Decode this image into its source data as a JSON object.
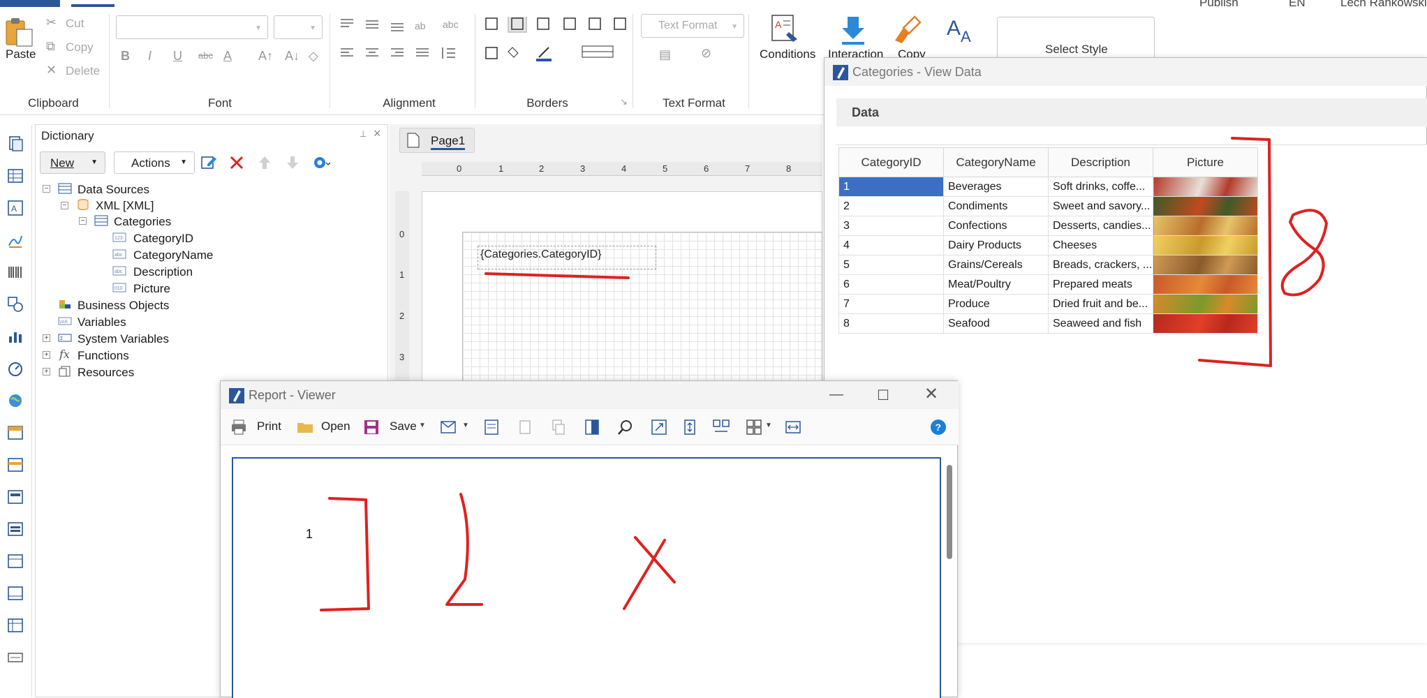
{
  "ribbon": {
    "clipboard": {
      "paste_label": "Paste",
      "cut_label": "Cut",
      "copy_label": "Copy",
      "delete_label": "Delete",
      "group_label": "Clipboard"
    },
    "font": {
      "group_label": "Font"
    },
    "alignment": {
      "group_label": "Alignment"
    },
    "borders": {
      "group_label": "Borders"
    },
    "text_format": {
      "combo_label": "Text Format",
      "group_label": "Text Format"
    },
    "conditions_label": "Conditions",
    "interaction_label": "Interaction",
    "copy_style_label": "Copy",
    "select_style_label": "Select Style",
    "top_right": {
      "publish": "Publish",
      "lang": "EN",
      "user": "Lech Rahkowski"
    }
  },
  "dictionary": {
    "title": "Dictionary",
    "new_button": "New",
    "actions_button": "Actions",
    "tree": {
      "data_sources": "Data Sources",
      "xml": "XML [XML]",
      "categories": "Categories",
      "fields": [
        "CategoryID",
        "CategoryName",
        "Description",
        "Picture"
      ],
      "business_objects": "Business Objects",
      "variables": "Variables",
      "system_variables": "System Variables",
      "functions": "Functions",
      "resources": "Resources"
    }
  },
  "designer": {
    "page_tab": "Page1",
    "ruler_h": [
      "0",
      "1",
      "2",
      "3",
      "4",
      "5",
      "6",
      "7",
      "8"
    ],
    "ruler_v": [
      "0",
      "1",
      "2",
      "3"
    ],
    "band_expression": "{Categories.CategoryID}"
  },
  "view_data": {
    "title": "Categories - View Data",
    "section": "Data",
    "columns": [
      "CategoryID",
      "CategoryName",
      "Description",
      "Picture"
    ],
    "rows": [
      {
        "id": "1",
        "name": "Beverages",
        "desc": "Soft drinks, coffe...",
        "pic_colors": [
          "#b33a2a",
          "#e8e0d8"
        ]
      },
      {
        "id": "2",
        "name": "Condiments",
        "desc": "Sweet and savory...",
        "pic_colors": [
          "#3f5a2a",
          "#c24a1e"
        ]
      },
      {
        "id": "3",
        "name": "Confections",
        "desc": "Desserts, candies...",
        "pic_colors": [
          "#e7c46a",
          "#b86d2a"
        ]
      },
      {
        "id": "4",
        "name": "Dairy Products",
        "desc": "Cheeses",
        "pic_colors": [
          "#f0d060",
          "#c89a2e"
        ]
      },
      {
        "id": "5",
        "name": "Grains/Cereals",
        "desc": "Breads, crackers, ...",
        "pic_colors": [
          "#cf9a55",
          "#8a5a2c"
        ]
      },
      {
        "id": "6",
        "name": "Meat/Poultry",
        "desc": "Prepared meats",
        "pic_colors": [
          "#c85a28",
          "#e58a3a"
        ]
      },
      {
        "id": "7",
        "name": "Produce",
        "desc": "Dried fruit and be...",
        "pic_colors": [
          "#d88a2a",
          "#7a9a2a"
        ]
      },
      {
        "id": "8",
        "name": "Seafood",
        "desc": "Seaweed and fish",
        "pic_colors": [
          "#b8281e",
          "#e04028"
        ]
      }
    ]
  },
  "report_viewer": {
    "title": "Report - Viewer",
    "print_label": "Print",
    "open_label": "Open",
    "save_label": "Save",
    "rendered_value": "1"
  },
  "colors": {
    "accent": "#2b579a",
    "selection": "#3c6fc4",
    "annotation": "#e02020"
  }
}
